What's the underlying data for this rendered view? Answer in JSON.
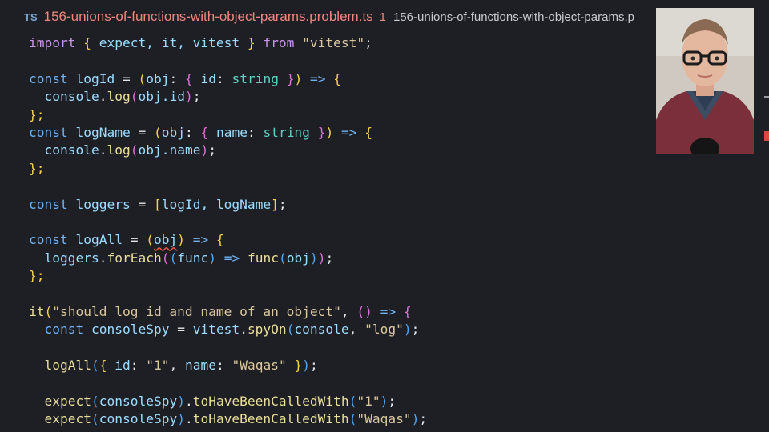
{
  "tabs": {
    "language_badge": "TS",
    "active_file": "156-unions-of-functions-with-object-params.problem.ts",
    "problem_count": "1",
    "second_file": "156-unions-of-functions-with-object-params.p"
  },
  "code": {
    "l1": {
      "t1": "import",
      "t2": "{",
      "t3": "expect, it, vitest",
      "t4": "}",
      "t5": "from",
      "t6": "\"vitest\"",
      "t7": ";"
    },
    "l3": {
      "t1": "const",
      "t2": "logId",
      "t3": "=",
      "t4": "(",
      "t5": "obj",
      "t6": ":",
      "t7": "{",
      "t8": "id",
      "t9": ":",
      "t10": "string",
      "t11": "}",
      "t12": ")",
      "t13": "=>",
      "t14": "{"
    },
    "l4": {
      "t1": "console",
      "t2": ".",
      "t3": "log",
      "t4": "(",
      "t5": "obj.id",
      "t6": ")",
      "t7": ";"
    },
    "l5": {
      "t1": "};"
    },
    "l6": {
      "t1": "const",
      "t2": "logName",
      "t3": "=",
      "t4": "(",
      "t5": "obj",
      "t6": ":",
      "t7": "{",
      "t8": "name",
      "t9": ":",
      "t10": "string",
      "t11": "}",
      "t12": ")",
      "t13": "=>",
      "t14": "{"
    },
    "l7": {
      "t1": "console",
      "t2": ".",
      "t3": "log",
      "t4": "(",
      "t5": "obj.name",
      "t6": ")",
      "t7": ";"
    },
    "l8": {
      "t1": "};"
    },
    "l10": {
      "t1": "const",
      "t2": "loggers",
      "t3": "=",
      "t4": "[",
      "t5": "logId, logName",
      "t6": "]",
      "t7": ";"
    },
    "l12": {
      "t1": "const",
      "t2": "logAll",
      "t3": "=",
      "t4": "(",
      "t5": "obj",
      "t6": ")",
      "t7": "=>",
      "t8": "{"
    },
    "l13": {
      "t1": "loggers",
      "t2": ".",
      "t3": "forEach",
      "t4": "(",
      "t5": "(",
      "t6": "func",
      "t7": ")",
      "t8": "=>",
      "t9": "func",
      "t10": "(",
      "t11": "obj",
      "t12": ")",
      "t13": ")",
      "t14": ";"
    },
    "l14": {
      "t1": "};"
    },
    "l16": {
      "t1": "it",
      "t2": "(",
      "t3": "\"should log id and name of an object\"",
      "t4": ",",
      "t5": "()",
      "t6": "=>",
      "t7": "{"
    },
    "l17": {
      "t1": "const",
      "t2": "consoleSpy",
      "t3": "=",
      "t4": "vitest",
      "t5": ".",
      "t6": "spyOn",
      "t7": "(",
      "t8": "console",
      "t9": ",",
      "t10": "\"log\"",
      "t11": ")",
      "t12": ";"
    },
    "l19": {
      "t1": "logAll",
      "t2": "(",
      "t3": "{",
      "t4": "id",
      "t5": ":",
      "t6": "\"1\"",
      "t7": ",",
      "t8": "name",
      "t9": ":",
      "t10": "\"Waqas\"",
      "t11": "}",
      "t12": ")",
      "t13": ";"
    },
    "l21": {
      "t1": "expect",
      "t2": "(",
      "t3": "consoleSpy",
      "t4": ")",
      "t5": ".",
      "t6": "toHaveBeenCalledWith",
      "t7": "(",
      "t8": "\"1\"",
      "t9": ")",
      "t10": ";"
    },
    "l22": {
      "t1": "expect",
      "t2": "(",
      "t3": "consoleSpy",
      "t4": ")",
      "t5": ".",
      "t6": "toHaveBeenCalledWith",
      "t7": "(",
      "t8": "\"Waqas\"",
      "t9": ")",
      "t10": ";"
    }
  },
  "colors": {
    "background": "#1e1f24",
    "error_tab": "#f0867d",
    "keyword_const": "#6fb3f5",
    "keyword_import": "#c994ec",
    "string": "#d9c7a0",
    "type": "#5fd1c3",
    "function": "#e7df9a"
  },
  "icons": {
    "webcam": "presenter-webcam-overlay"
  }
}
